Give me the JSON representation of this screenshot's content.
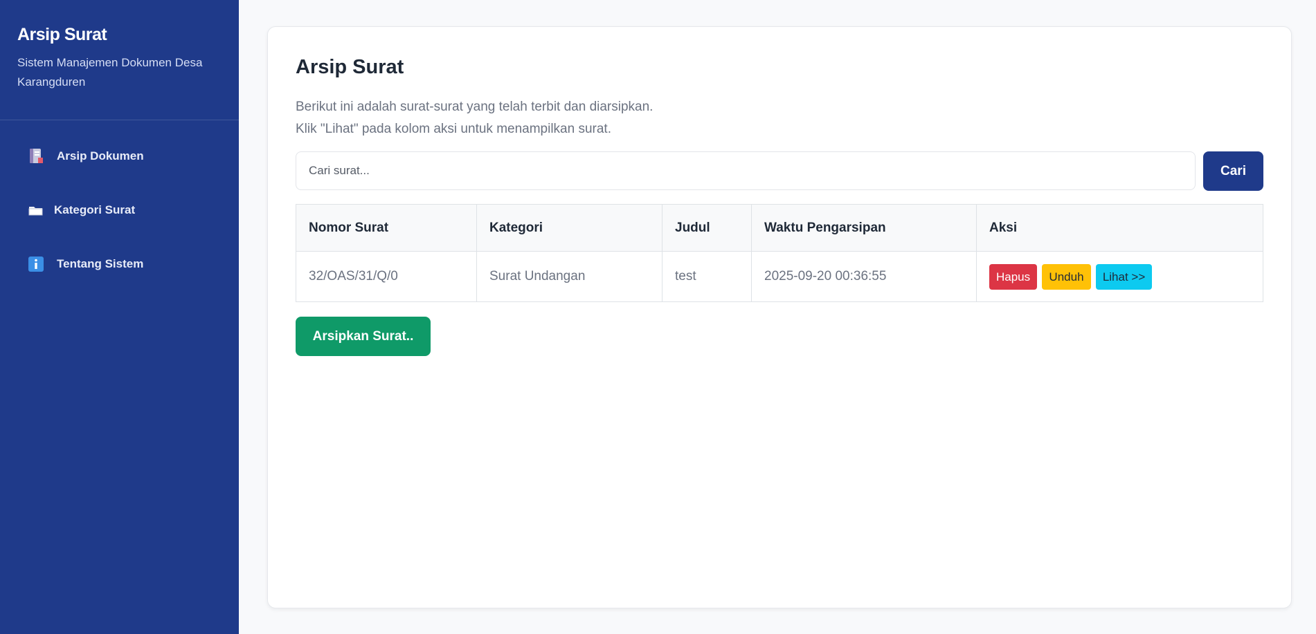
{
  "sidebar": {
    "title": "Arsip Surat",
    "subtitle": "Sistem Manajemen Dokumen Desa Karangduren",
    "items": [
      {
        "label": "Arsip Dokumen",
        "icon": "notebook-icon"
      },
      {
        "label": "Kategori Surat",
        "icon": "folder-icon"
      },
      {
        "label": "Tentang Sistem",
        "icon": "info-icon"
      }
    ]
  },
  "main": {
    "title": "Arsip Surat",
    "description_line1": "Berikut ini adalah surat-surat yang telah terbit dan diarsipkan.",
    "description_line2": "Klik \"Lihat\" pada kolom aksi untuk menampilkan surat.",
    "search": {
      "placeholder": "Cari surat...",
      "value": "",
      "button_label": "Cari"
    },
    "table": {
      "headers": [
        "Nomor Surat",
        "Kategori",
        "Judul",
        "Waktu Pengarsipan",
        "Aksi"
      ],
      "rows": [
        {
          "nomor": "32/OAS/31/Q/0",
          "kategori": "Surat Undangan",
          "judul": "test",
          "waktu": "2025-09-20 00:36:55",
          "actions": {
            "delete": "Hapus",
            "download": "Unduh",
            "view": "Lihat >>"
          }
        }
      ]
    },
    "archive_button_label": "Arsipkan Surat.."
  },
  "colors": {
    "sidebar_bg": "#1f3a8a",
    "primary": "#1f3a8a",
    "success": "#0f9a68",
    "danger": "#dc3545",
    "warning": "#ffc107",
    "info": "#0dcaf0"
  }
}
